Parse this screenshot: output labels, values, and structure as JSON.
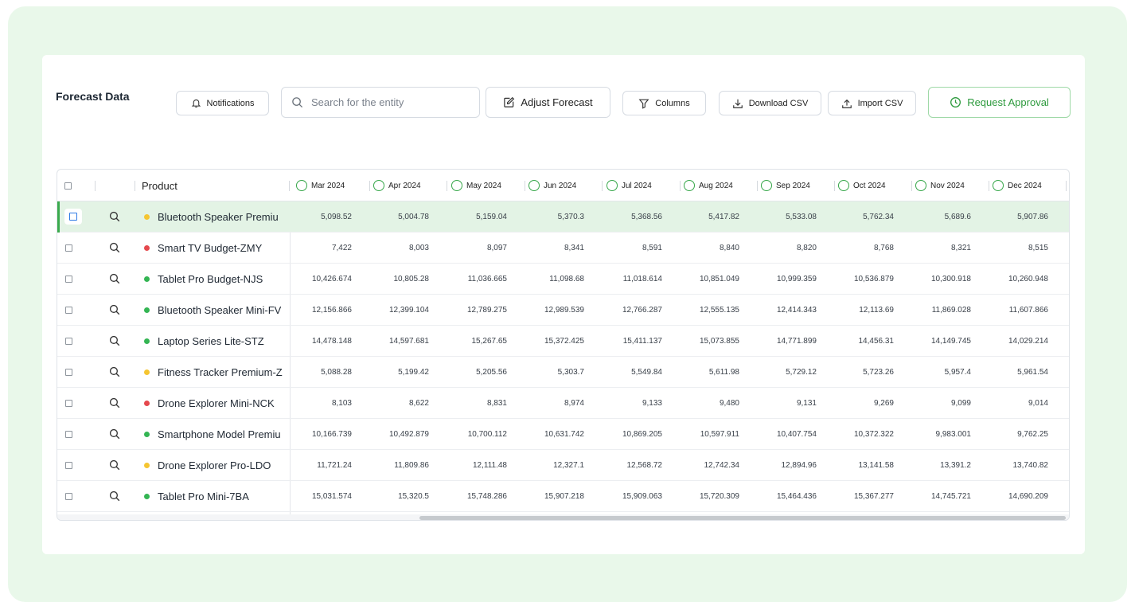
{
  "header": {
    "title": "Forecast Data",
    "notifications_label": "Notifications",
    "search_placeholder": "Search for the entity",
    "adjust_label": "Adjust Forecast",
    "columns_label": "Columns",
    "download_label": "Download CSV",
    "import_label": "Import CSV",
    "approval_label": "Request Approval"
  },
  "table": {
    "product_header": "Product",
    "months": [
      "Mar 2024",
      "Apr 2024",
      "May 2024",
      "Jun 2024",
      "Jul 2024",
      "Aug 2024",
      "Sep 2024",
      "Oct 2024",
      "Nov 2024",
      "Dec 2024"
    ],
    "rows": [
      {
        "name": "Bluetooth Speaker Premiu",
        "status": "#f5c531",
        "values": [
          "5,098.52",
          "5,004.78",
          "5,159.04",
          "5,370.3",
          "5,368.56",
          "5,417.82",
          "5,533.08",
          "5,762.34",
          "5,689.6",
          "5,907.86"
        ]
      },
      {
        "name": "Smart TV Budget-ZMY",
        "status": "#e5484d",
        "values": [
          "7,422",
          "8,003",
          "8,097",
          "8,341",
          "8,591",
          "8,840",
          "8,820",
          "8,768",
          "8,321",
          "8,515"
        ]
      },
      {
        "name": "Tablet Pro Budget-NJS",
        "status": "#34b553",
        "values": [
          "10,426.674",
          "10,805.28",
          "11,036.665",
          "11,098.68",
          "11,018.614",
          "10,851.049",
          "10,999.359",
          "10,536.879",
          "10,300.918",
          "10,260.948"
        ]
      },
      {
        "name": "Bluetooth Speaker Mini-FV",
        "status": "#34b553",
        "values": [
          "12,156.866",
          "12,399.104",
          "12,789.275",
          "12,989.539",
          "12,766.287",
          "12,555.135",
          "12,414.343",
          "12,113.69",
          "11,869.028",
          "11,607.866"
        ]
      },
      {
        "name": "Laptop Series Lite-STZ",
        "status": "#34b553",
        "values": [
          "14,478.148",
          "14,597.681",
          "15,267.65",
          "15,372.425",
          "15,411.137",
          "15,073.855",
          "14,771.899",
          "14,456.31",
          "14,149.745",
          "14,029.214"
        ]
      },
      {
        "name": "Fitness Tracker Premium-Z",
        "status": "#f5c531",
        "values": [
          "5,088.28",
          "5,199.42",
          "5,205.56",
          "5,303.7",
          "5,549.84",
          "5,611.98",
          "5,729.12",
          "5,723.26",
          "5,957.4",
          "5,961.54"
        ]
      },
      {
        "name": "Drone Explorer Mini-NCK",
        "status": "#e5484d",
        "values": [
          "8,103",
          "8,622",
          "8,831",
          "8,974",
          "9,133",
          "9,480",
          "9,131",
          "9,269",
          "9,099",
          "9,014"
        ]
      },
      {
        "name": "Smartphone Model Premiu",
        "status": "#34b553",
        "values": [
          "10,166.739",
          "10,492.879",
          "10,700.112",
          "10,631.742",
          "10,869.205",
          "10,597.911",
          "10,407.754",
          "10,372.322",
          "9,983.001",
          "9,762.25"
        ]
      },
      {
        "name": "Drone Explorer Pro-LDO",
        "status": "#f5c531",
        "values": [
          "11,721.24",
          "11,809.86",
          "12,111.48",
          "12,327.1",
          "12,568.72",
          "12,742.34",
          "12,894.96",
          "13,141.58",
          "13,391.2",
          "13,740.82"
        ]
      },
      {
        "name": "Tablet Pro Mini-7BA",
        "status": "#34b553",
        "values": [
          "15,031.574",
          "15,320.5",
          "15,748.286",
          "15,907.218",
          "15,909.063",
          "15,720.309",
          "15,464.436",
          "15,367.277",
          "14,745.721",
          "14,690.209"
        ]
      }
    ]
  }
}
